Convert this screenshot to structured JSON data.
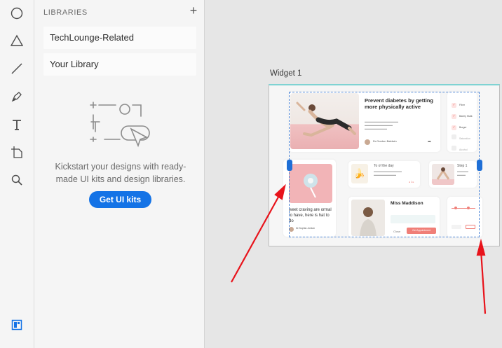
{
  "toolbar": {
    "tools": [
      "ellipse-tool",
      "triangle-tool",
      "line-tool",
      "pen-tool",
      "text-tool",
      "artboard-tool",
      "zoom-tool"
    ],
    "bottom": "libraries-icon"
  },
  "libraries": {
    "title": "LIBRARIES",
    "add_label": "+",
    "items": [
      {
        "label": "TechLounge-Related"
      },
      {
        "label": "Your Library"
      }
    ],
    "empty_text": "Kickstart your designs with ready-made UI kits and design libraries.",
    "cta_label": "Get UI kits"
  },
  "canvas": {
    "artboard_title": "Widget 1",
    "widget": {
      "hero_title": "Prevent diabetes by getting more physically active",
      "hero_author": "Dr.Gordon Baldwin",
      "todo_title": "To of the day",
      "step_title": "Step 1",
      "left_caption": "weet craving are ormal to have, here is hat to do",
      "left_author": "Dr.Sophia Jordan",
      "doctor_name": "Miss Maddison",
      "close_label": "Close",
      "appointment_label": "Get Appointment",
      "checklist": [
        "Fiber",
        "Barley Stalk",
        "Burger",
        "Saturation",
        "Alcohol"
      ]
    }
  },
  "colors": {
    "accent": "#1473e6",
    "selection": "#1f6fd6",
    "annotation": "#e8131b",
    "coral": "#f07f78"
  }
}
